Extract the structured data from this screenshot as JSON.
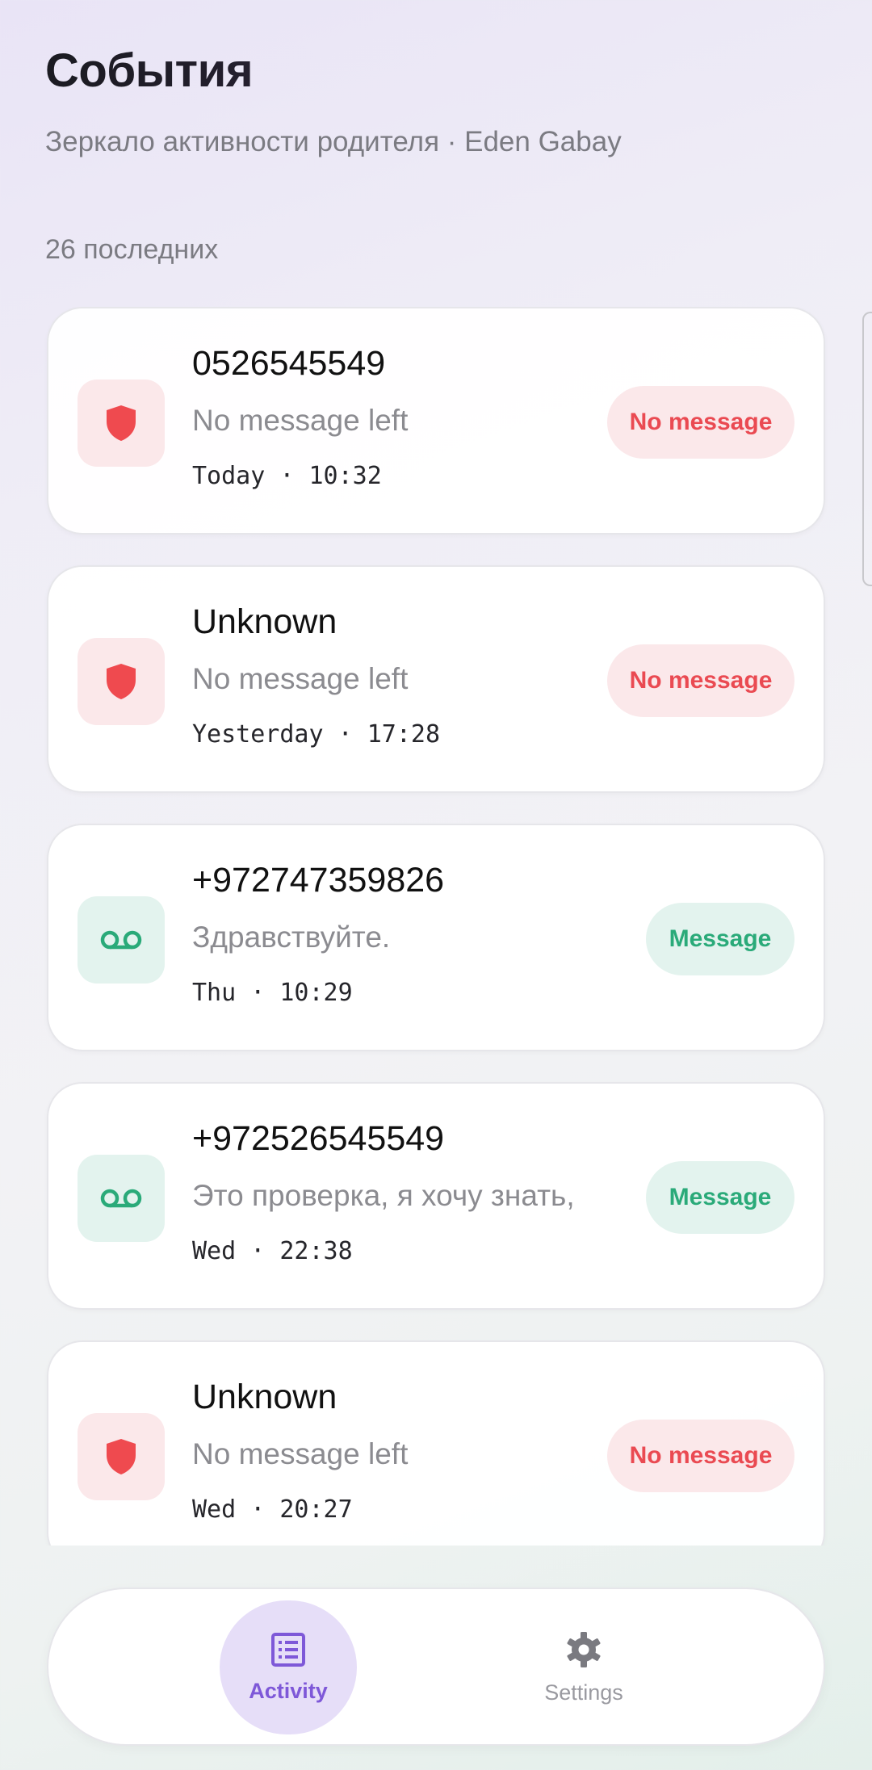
{
  "header": {
    "title": "События",
    "subtitle": "Зеркало активности родителя · Eden Gabay"
  },
  "list": {
    "count_label": "26 последних",
    "items": [
      {
        "name": "0526545549",
        "preview": "No message left",
        "time": "Today · 10:32",
        "badge": "No message",
        "kind": "blocked",
        "icon": "shield-icon"
      },
      {
        "name": "Unknown",
        "preview": "No message left",
        "time": "Yesterday · 17:28",
        "badge": "No message",
        "kind": "blocked",
        "icon": "shield-icon"
      },
      {
        "name": "+972747359826",
        "preview": "Здравствуйте.",
        "time": "Thu · 10:29",
        "badge": "Message",
        "kind": "voicemail",
        "icon": "voicemail-icon"
      },
      {
        "name": "+972526545549",
        "preview": "Это проверка, я хочу знать,",
        "time": "Wed · 22:38",
        "badge": "Message",
        "kind": "voicemail",
        "icon": "voicemail-icon"
      },
      {
        "name": "Unknown",
        "preview": "No message left",
        "time": "Wed · 20:27",
        "badge": "No message",
        "kind": "blocked",
        "icon": "shield-icon"
      }
    ]
  },
  "nav": {
    "activity_label": "Activity",
    "settings_label": "Settings",
    "active": "Activity"
  },
  "colors": {
    "accent": "#7e58d8",
    "danger": "#ea4a52",
    "success": "#2aaa79"
  }
}
